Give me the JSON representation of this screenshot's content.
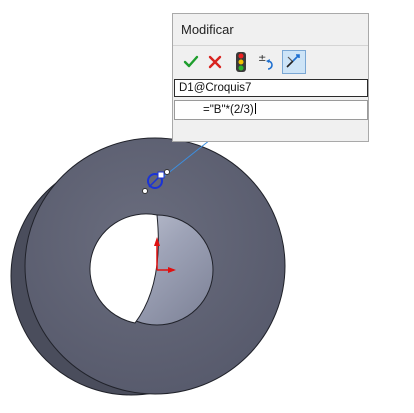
{
  "dialog": {
    "title": "Modificar",
    "toolbar": [
      {
        "name": "ok",
        "icon": "checkmark-icon",
        "color": "#1e9e2d"
      },
      {
        "name": "cancel",
        "icon": "close-icon",
        "color": "#d8231f"
      },
      {
        "name": "rebuild",
        "icon": "traffic-light-icon"
      },
      {
        "name": "reset-spin",
        "icon": "spin-reset-icon"
      },
      {
        "name": "mark-dimension",
        "icon": "mark-dimension-icon",
        "active": true
      }
    ],
    "dimension_name": "D1@Croquis7",
    "expression": "=\"B\"*(2/3)"
  },
  "model": {
    "body_color": "#5d6070",
    "inner_color": "#9aa0b4",
    "accent_color": "#1a33d6"
  }
}
